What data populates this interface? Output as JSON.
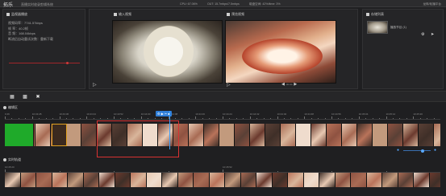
{
  "topbar": {
    "brand": "拓乐",
    "app_name": "直播实时收录剪辑系统",
    "cpu": "CPU: 67.06%",
    "network": "OUT: 15.7mbps/7.5mbps",
    "disk": "磁盘空间: 42%/time: 3%",
    "right": "龙珠/轮播平台"
  },
  "monitor": {
    "title": "监视器播放",
    "stats": [
      "视频码率：7741.57kbps",
      "帧      率：40.2帧",
      "音      频：168.04kbps",
      "断流后自动重试次数：重新下载"
    ],
    "level": 0.82
  },
  "preview": {
    "left_title": "输入视频",
    "right_title": "预览视频",
    "right_timecode": "00:00"
  },
  "playlist": {
    "title": "存储列表",
    "item_name": "播放节目 (1)"
  },
  "edit_track": {
    "title": "编辑区",
    "ruler": [
      "0:46",
      "10:43:28",
      "10:43:36",
      "10:43:44",
      "10:43:52",
      "10:44:00",
      "10:44:08",
      "10:44:16",
      "10:44:24",
      "10:44:32",
      "10:44:40",
      "10:44:48",
      "10:44:56",
      "10:45:04",
      "10:45:12",
      "10:45:20"
    ],
    "zoom": 0.7
  },
  "live_track": {
    "title": "实时轨道",
    "ruler": [
      "10:45:20",
      "10:45:52"
    ]
  },
  "colors": {
    "accent": "#2f7ed8",
    "selection": "#d93232",
    "green_clip": "#1faa2a",
    "background": "#1f1f21"
  }
}
